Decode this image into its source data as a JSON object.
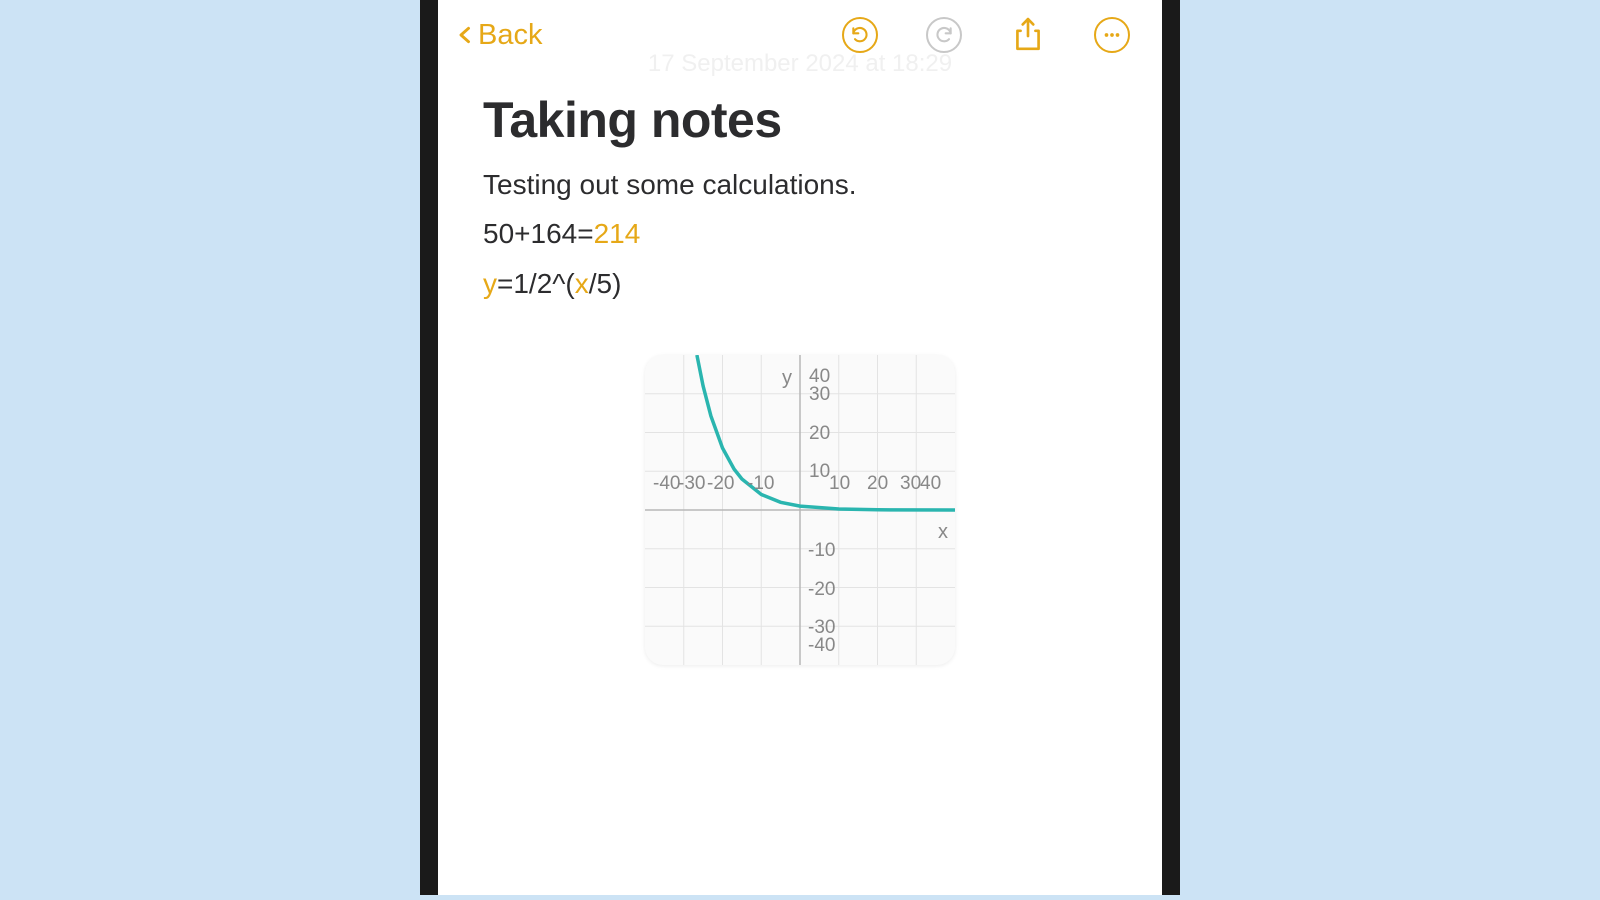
{
  "toolbar": {
    "back_label": "Back"
  },
  "ghost_text": "17 September 2024 at 18:29",
  "note": {
    "title": "Taking notes",
    "body_line": "Testing out some calculations.",
    "calc_lhs": "50+164=",
    "calc_result": "214",
    "eq_y": "y",
    "eq_mid": "=1/2^(",
    "eq_x": "x",
    "eq_end": "/5)"
  },
  "chart_data": {
    "type": "line",
    "function": "y = 1/2^(x/5)",
    "xlabel": "x",
    "ylabel": "y",
    "xlim": [
      -40,
      40
    ],
    "ylim": [
      -40,
      40
    ],
    "x_ticks": [
      -40,
      -30,
      -20,
      -10,
      10,
      20,
      30,
      40
    ],
    "y_ticks": [
      -40,
      -30,
      -20,
      -10,
      10,
      20,
      30,
      40
    ],
    "y_tick_labels_pos": [
      "40",
      "30",
      "20",
      "10"
    ],
    "y_tick_labels_neg": [
      "-10",
      "-20",
      "-30",
      "-40"
    ],
    "x_tick_labels_neg": [
      "-40",
      "-30",
      "-20",
      "-10"
    ],
    "x_tick_labels_pos": [
      "10",
      "20",
      "30",
      "40"
    ],
    "series": [
      {
        "name": "y=1/2^(x/5)",
        "points": [
          [
            -26.6,
            40
          ],
          [
            -25,
            32
          ],
          [
            -23,
            24.25
          ],
          [
            -20,
            16
          ],
          [
            -17,
            10.56
          ],
          [
            -15,
            8
          ],
          [
            -10,
            4
          ],
          [
            -5,
            2
          ],
          [
            0,
            1
          ],
          [
            10,
            0.25
          ],
          [
            20,
            0.0625
          ],
          [
            40,
            0.0039
          ]
        ]
      }
    ]
  },
  "colors": {
    "accent": "#e6a817",
    "curve": "#2ab5af",
    "page_bg": "#cce3f5"
  }
}
